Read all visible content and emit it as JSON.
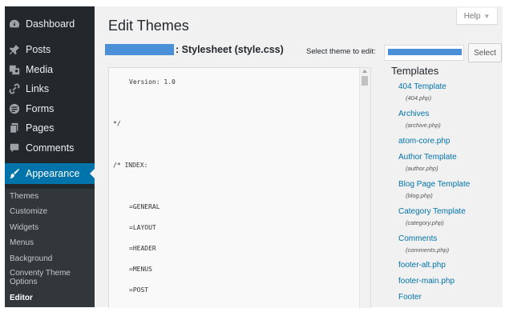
{
  "sidebar": {
    "items": [
      {
        "label": "Dashboard",
        "icon": "dashboard-icon"
      },
      {
        "label": "Posts",
        "icon": "pin-icon"
      },
      {
        "label": "Media",
        "icon": "media-icon"
      },
      {
        "label": "Links",
        "icon": "link-icon"
      },
      {
        "label": "Forms",
        "icon": "forms-icon"
      },
      {
        "label": "Pages",
        "icon": "pages-icon"
      },
      {
        "label": "Comments",
        "icon": "comments-icon"
      },
      {
        "label": "Appearance",
        "icon": "brush-icon"
      }
    ],
    "submenu": [
      "Themes",
      "Customize",
      "Widgets",
      "Menus",
      "Background",
      "Conventy Theme Options",
      "Editor"
    ]
  },
  "header": {
    "help_label": "Help",
    "title": "Edit Themes",
    "file_title": ": Stylesheet (style.css)",
    "select_label": "Select theme to edit:",
    "select_button": "Select"
  },
  "editor": {
    "lines": [
      "Version: 1.0",
      "*/",
      "/* INDEX:",
      "=GENERAL",
      "=LAYOUT",
      "=HEADER",
      "=MENUS",
      "=POST"
    ]
  },
  "templates": {
    "heading": "Templates",
    "items": [
      {
        "name": "404 Template",
        "file": "(404.php)"
      },
      {
        "name": "Archives",
        "file": "(archive.php)"
      },
      {
        "name": "atom-core.php",
        "file": ""
      },
      {
        "name": "Author Template",
        "file": "(author.php)"
      },
      {
        "name": "Blog Page Template",
        "file": "(blog.php)"
      },
      {
        "name": "Category Template",
        "file": "(category.php)"
      },
      {
        "name": "Comments",
        "file": "(comments.php)"
      },
      {
        "name": "footer-alt.php",
        "file": ""
      },
      {
        "name": "footer-main.php",
        "file": ""
      },
      {
        "name": "Footer",
        "file": ""
      }
    ]
  },
  "colors": {
    "sidebar_bg": "#23282d",
    "submenu_bg": "#32373c",
    "accent": "#0073aa",
    "main_bg": "#f1f1f1",
    "redaction": "#4a90d9"
  }
}
